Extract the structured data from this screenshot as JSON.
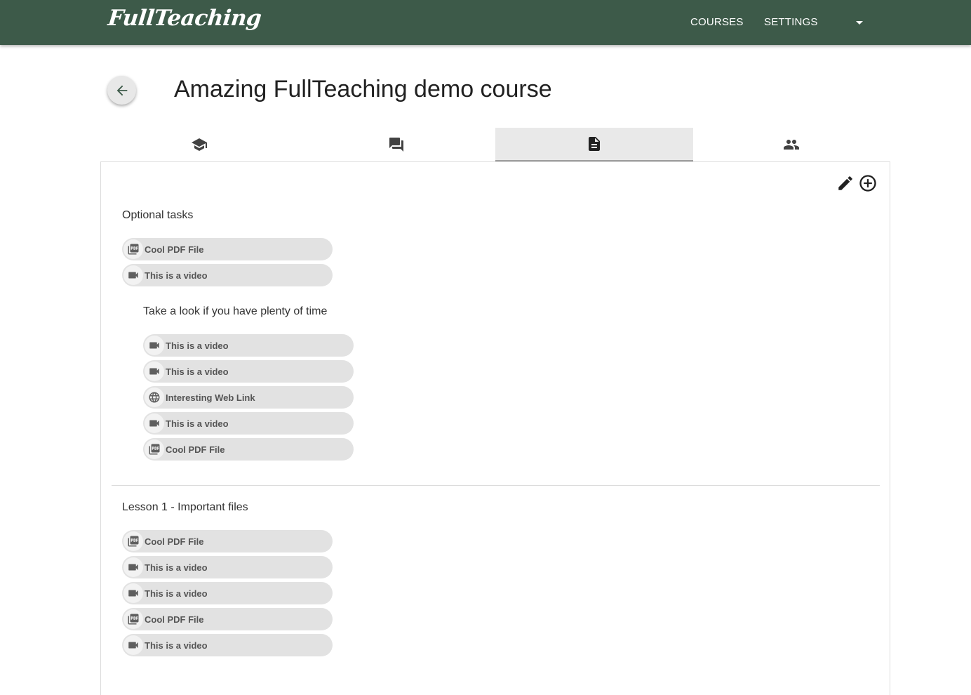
{
  "navbar": {
    "brand": "FullTeaching",
    "links": [
      "COURSES",
      "SETTINGS"
    ]
  },
  "page": {
    "title": "Amazing FullTeaching demo course"
  },
  "tabs": [
    {
      "icon": "school-icon",
      "active": false
    },
    {
      "icon": "forum-icon",
      "active": false
    },
    {
      "icon": "file-icon",
      "active": true
    },
    {
      "icon": "people-icon",
      "active": false
    }
  ],
  "toolbar": {
    "icons": [
      "edit-icon",
      "add-circle-icon"
    ]
  },
  "sections": [
    {
      "title": "Optional tasks",
      "items": [
        {
          "type": "pdf",
          "label": "Cool PDF File"
        },
        {
          "type": "video",
          "label": "This is a video"
        }
      ],
      "subsection": {
        "title": "Take a look if you have plenty of time",
        "items": [
          {
            "type": "video",
            "label": "This is a video"
          },
          {
            "type": "video",
            "label": "This is a video"
          },
          {
            "type": "link",
            "label": "Interesting Web Link"
          },
          {
            "type": "video",
            "label": "This is a video"
          },
          {
            "type": "pdf",
            "label": "Cool PDF File"
          }
        ]
      }
    },
    {
      "title": "Lesson 1 - Important files",
      "items": [
        {
          "type": "pdf",
          "label": "Cool PDF File"
        },
        {
          "type": "video",
          "label": "This is a video"
        },
        {
          "type": "video",
          "label": "This is a video"
        },
        {
          "type": "pdf",
          "label": "Cool PDF File"
        },
        {
          "type": "video",
          "label": "This is a video"
        }
      ]
    }
  ],
  "colors": {
    "navbar": "#3d5a49",
    "chip": "#e2e2e2",
    "tab_active": "#e9e9e9"
  }
}
